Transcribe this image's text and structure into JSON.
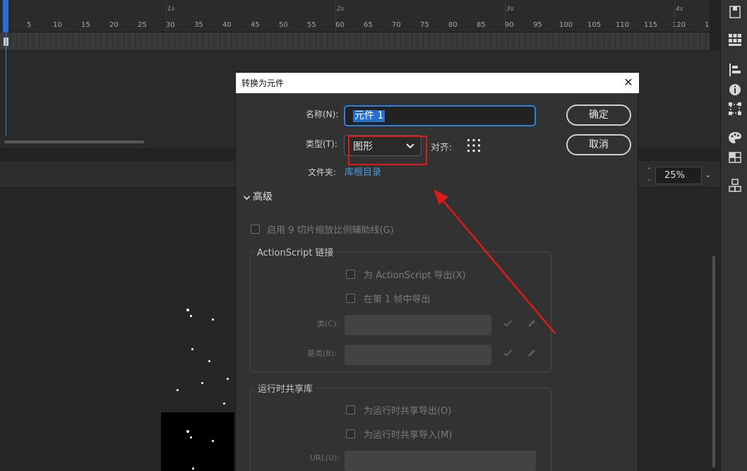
{
  "timeline": {
    "seconds": [
      {
        "label": "1s",
        "frame": 30
      },
      {
        "label": "2s",
        "frame": 60
      },
      {
        "label": "3s",
        "frame": 90
      },
      {
        "label": "4s",
        "frame": 120
      }
    ],
    "frame_ticks": [
      "5",
      "10",
      "15",
      "20",
      "25",
      "30",
      "35",
      "40",
      "45",
      "50",
      "55",
      "60",
      "65",
      "70",
      "75",
      "80",
      "85",
      "90",
      "95",
      "100",
      "105",
      "110",
      "115",
      "120",
      "1"
    ]
  },
  "stage": {
    "zoom": "25%"
  },
  "dialog": {
    "title": "转换为元件",
    "name_label": "名称(N):",
    "name_value": "元件 1",
    "type_label": "类型(T):",
    "type_value": "图形",
    "align_label": "对齐:",
    "folder_label": "文件夹:",
    "folder_link": "库根目录",
    "ok_button": "确定",
    "cancel_button": "取消",
    "advanced_label": "高级",
    "nine_slice_label": "启用 9 切片缩放比例辅助线(G)",
    "actionscript": {
      "group_title": "ActionScript 链接",
      "export_for_as": "为 ActionScript 导出(X)",
      "export_in_frame1": "在第 1 帧中导出",
      "class_label": "类(C):",
      "base_class_label": "基类(B):"
    },
    "runtime_shared": {
      "group_title": "运行时共享库",
      "export_for_runtime": "为运行时共享导出(O)",
      "import_for_runtime": "为运行时共享导入(M)",
      "url_label": "URL(U):"
    }
  },
  "colors": {
    "accent_blue": "#2f7fe0",
    "annotation_red": "#e01818",
    "dialog_bg": "#323232"
  }
}
